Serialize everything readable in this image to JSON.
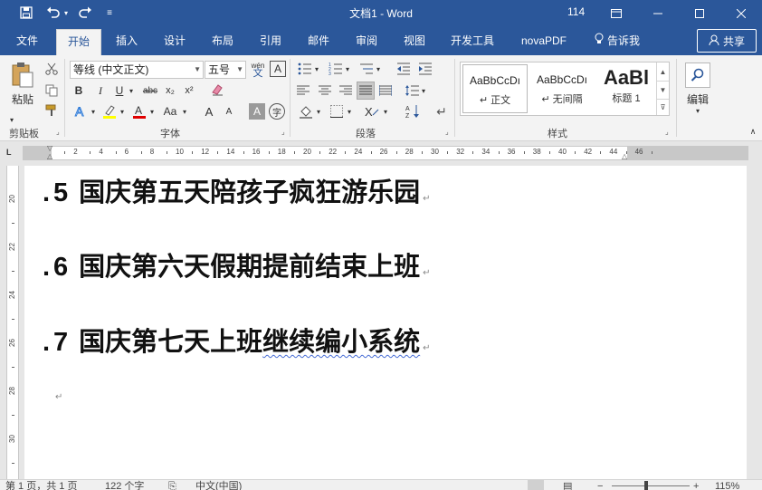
{
  "window": {
    "title": "文档1 - Word",
    "counter": "114",
    "quick_access": [
      "save-icon",
      "undo-icon",
      "redo-icon",
      "customize-icon"
    ]
  },
  "tabs": [
    {
      "label": "文件"
    },
    {
      "label": "开始"
    },
    {
      "label": "插入"
    },
    {
      "label": "设计"
    },
    {
      "label": "布局"
    },
    {
      "label": "引用"
    },
    {
      "label": "邮件"
    },
    {
      "label": "审阅"
    },
    {
      "label": "视图"
    },
    {
      "label": "开发工具"
    },
    {
      "label": "novaPDF"
    },
    {
      "label": "告诉我"
    }
  ],
  "active_tab": "开始",
  "share_label": "共享",
  "ribbon": {
    "clipboard": {
      "paste_label": "粘贴",
      "group_label": "剪贴板"
    },
    "font": {
      "font_name": "等线 (中文正文)",
      "font_size": "五号",
      "wen_label": "wén",
      "wen_char": "文",
      "group_label": "字体",
      "bold": "B",
      "italic": "I",
      "underline": "U",
      "strike": "abc",
      "subscript": "x₂",
      "superscript": "x²",
      "grow": "A",
      "shrink": "A",
      "aa": "Aa",
      "char_border": "A",
      "char_shade": "A",
      "enclose": "字"
    },
    "paragraph": {
      "group_label": "段落"
    },
    "styles": {
      "group_label": "样式",
      "items": [
        {
          "sample": "AaBbCcDı",
          "name": "↵ 正文"
        },
        {
          "sample": "AaBbCcDı",
          "name": "↵ 无间隔"
        },
        {
          "sample": "AaBl",
          "name": "标题 1"
        }
      ]
    },
    "editing": {
      "label": "编辑"
    }
  },
  "ruler": {
    "h_numbers": [
      "2",
      "4",
      "6",
      "8",
      "10",
      "12",
      "14",
      "16",
      "18",
      "20",
      "22",
      "24",
      "26",
      "28",
      "30",
      "32",
      "34",
      "36",
      "38",
      "40",
      "42",
      "44",
      "46"
    ],
    "v_numbers": [
      "20",
      "22",
      "24",
      "26",
      "28",
      "30",
      "32"
    ]
  },
  "document": {
    "lines": [
      {
        "bullet": ".",
        "num": "5",
        "text": "国庆第五天陪孩子疯狂游乐园",
        "mark": "↵"
      },
      {
        "bullet": ".",
        "num": "6",
        "text": "国庆第六天假期提前结束上班",
        "mark": "↵"
      },
      {
        "bullet": ".",
        "num": "7",
        "text_plain": "国庆第七天上班",
        "text_squiggle": "继续编小系统",
        "mark": "↵"
      }
    ],
    "empty_mark": "↵"
  },
  "status": {
    "page": "第 1 页，共 1 页",
    "words": "122 个字",
    "language": "中文(中国)",
    "zoom": "115%"
  }
}
